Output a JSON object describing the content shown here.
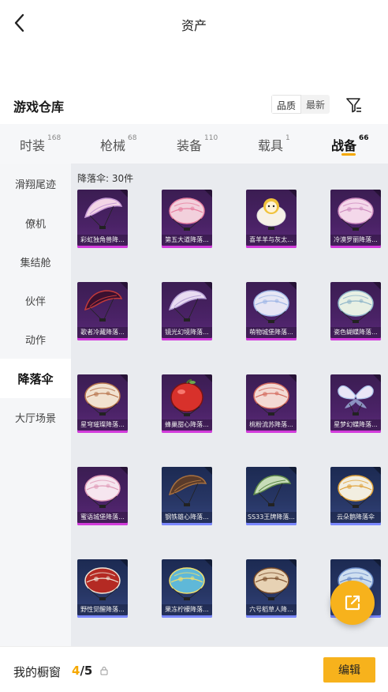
{
  "header": {
    "title": "资产"
  },
  "section": {
    "title": "游戏仓库",
    "sort_options": [
      "品质",
      "最新"
    ]
  },
  "tabs": [
    {
      "label": "时装",
      "count": "168"
    },
    {
      "label": "枪械",
      "count": "68"
    },
    {
      "label": "装备",
      "count": "110"
    },
    {
      "label": "载具",
      "count": "1"
    },
    {
      "label": "战备",
      "count": "66"
    }
  ],
  "active_tab": "战备",
  "sidebar": {
    "items": [
      "滑翔尾迹",
      "僚机",
      "集结舱",
      "伙伴",
      "动作",
      "降落伞",
      "大厅场景"
    ],
    "active": "降落伞"
  },
  "content": {
    "count_label": "降落伞: 30件",
    "items": [
      {
        "name": "彩虹独角兽降...",
        "rarity": "purple",
        "color": "#f3d6e6",
        "accent": "#c79bd6",
        "shape": "glider"
      },
      {
        "name": "第五大道降落...",
        "rarity": "purple",
        "color": "#f2d0dc",
        "accent": "#e77fa0",
        "shape": "dome"
      },
      {
        "name": "喜羊羊与灰太...",
        "rarity": "purple",
        "color": "#f6f1e6",
        "accent": "#f0c23b",
        "shape": "sheep"
      },
      {
        "name": "冷漠罗丽降落...",
        "rarity": "purple",
        "color": "#f4d8ea",
        "accent": "#cf8ec0",
        "shape": "dome"
      },
      {
        "name": "歌者冷藏降落...",
        "rarity": "purple",
        "color": "#3a1030",
        "accent": "#c23a3a",
        "shape": "glider"
      },
      {
        "name": "镜光幻境降落...",
        "rarity": "purple",
        "color": "#e9dcf2",
        "accent": "#b7a2d6",
        "shape": "glider"
      },
      {
        "name": "萌物城堡降落...",
        "rarity": "purple",
        "color": "#e6e6f4",
        "accent": "#9fb6e6",
        "shape": "dome"
      },
      {
        "name": "瓷色蝴蝶降落...",
        "rarity": "purple",
        "color": "#e8f0e4",
        "accent": "#8fb6c9",
        "shape": "dome"
      },
      {
        "name": "星穹璀璨降落...",
        "rarity": "purple",
        "color": "#f1e2d0",
        "accent": "#b8754d",
        "shape": "dome"
      },
      {
        "name": "蜂巢甜心降落...",
        "rarity": "purple",
        "color": "#d8312b",
        "accent": "#7a1414",
        "shape": "apple"
      },
      {
        "name": "桃粉流苏降落...",
        "rarity": "purple",
        "color": "#f3dad4",
        "accent": "#d46a5e",
        "shape": "dome"
      },
      {
        "name": "星梦幻蝶降落...",
        "rarity": "purple",
        "color": "#e9e6f6",
        "accent": "#a9c3ea",
        "shape": "butterfly"
      },
      {
        "name": "蜜语城堡降落...",
        "rarity": "purple",
        "color": "#f6e6ef",
        "accent": "#e09bb8",
        "shape": "dome"
      },
      {
        "name": "钢铁雄心降落...",
        "rarity": "blue",
        "color": "#5a3b2a",
        "accent": "#a8703e",
        "shape": "glider"
      },
      {
        "name": "SS33王牌降落...",
        "rarity": "blue",
        "color": "#c7dcb8",
        "accent": "#5f8a4a",
        "shape": "glider"
      },
      {
        "name": "云朵鹅降落伞",
        "rarity": "blue",
        "color": "#f2eee0",
        "accent": "#e0a23a",
        "shape": "dome"
      },
      {
        "name": "野性觉醒降落...",
        "rarity": "blue",
        "color": "#b42a23",
        "accent": "#f0e6d8",
        "shape": "dome"
      },
      {
        "name": "果冻柠檬降落...",
        "rarity": "blue",
        "color": "#5fb8d8",
        "accent": "#f3e06a",
        "shape": "dome"
      },
      {
        "name": "六号稻草人降...",
        "rarity": "blue",
        "color": "#e7d2b4",
        "accent": "#7a4c2a",
        "shape": "dome"
      },
      {
        "name": "",
        "rarity": "blue",
        "color": "#cfe0f0",
        "accent": "#6b8cc8",
        "shape": "dome"
      }
    ]
  },
  "bottom": {
    "label": "我的橱窗",
    "current": "4",
    "separator": "/",
    "total": "5",
    "edit_label": "编辑"
  },
  "colors": {
    "accent": "#f5a800",
    "purple_rarity": "#d23bdb",
    "blue_rarity": "#7b88ff"
  },
  "icons": {
    "back": "chevron-left-icon",
    "filter": "filter-icon",
    "share": "external-link-icon",
    "lock": "lock-icon"
  }
}
